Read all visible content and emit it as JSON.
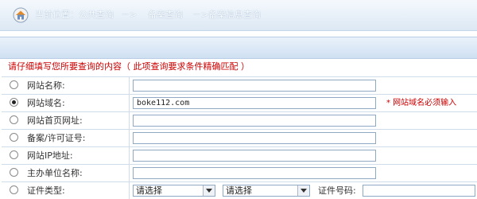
{
  "breadcrumb": {
    "label": "当前位置：",
    "level1": "公共查询",
    "sep1": "－>",
    "level2": "备案查询",
    "sep2": "－>",
    "level3": "备案信息查询"
  },
  "notice": "请仔细填写您所要查询的内容（ 此项查询要求条件精确匹配 ）",
  "form": {
    "rows": [
      {
        "label": "网站名称:",
        "value": "",
        "selected": false
      },
      {
        "label": "网站域名:",
        "value": "boke112.com",
        "selected": true,
        "hint": "* 网站域名必须输入"
      },
      {
        "label": "网站首页网址:",
        "value": "",
        "selected": false
      },
      {
        "label": "备案/许可证号:",
        "value": "",
        "selected": false
      },
      {
        "label": "网站IP地址:",
        "value": "",
        "selected": false
      },
      {
        "label": "主办单位名称:",
        "value": "",
        "selected": false
      }
    ],
    "cert_row": {
      "label": "证件类型:",
      "select1": "请选择",
      "select2": "请选择",
      "cert_no_label": "证件号码:"
    }
  }
}
